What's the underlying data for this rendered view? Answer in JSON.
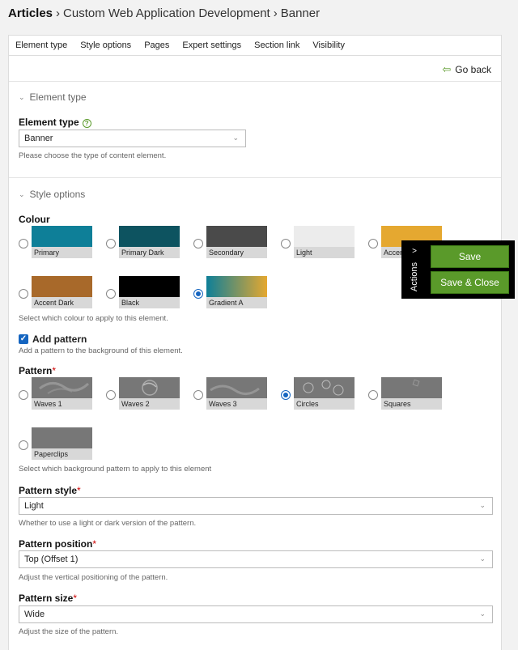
{
  "breadcrumb": {
    "root": "Articles",
    "items": [
      "Custom Web Application Development",
      "Banner"
    ]
  },
  "tabs": [
    "Element type",
    "Style options",
    "Pages",
    "Expert settings",
    "Section link",
    "Visibility"
  ],
  "go_back": "Go back",
  "element_type_section": {
    "title": "Element type",
    "label": "Element type",
    "value": "Banner",
    "hint": "Please choose the type of content element."
  },
  "style_section": {
    "title": "Style options",
    "colour_label": "Colour",
    "colours": [
      {
        "name": "Primary",
        "color": "#0e7f98"
      },
      {
        "name": "Primary Dark",
        "color": "#0d5360"
      },
      {
        "name": "Secondary",
        "color": "#4a4a4a"
      },
      {
        "name": "Light",
        "color": "#ececec"
      },
      {
        "name": "Accent",
        "color": "#e5a830"
      },
      {
        "name": "Accent Dark",
        "color": "#a8692a"
      },
      {
        "name": "Black",
        "color": "#000000"
      },
      {
        "name": "Gradient A",
        "color": "linear-gradient(90deg,#0e7f98,#e5a830)"
      }
    ],
    "selected_colour": "Gradient A",
    "colour_hint": "Select which colour to apply to this element.",
    "add_pattern_label": "Add pattern",
    "add_pattern_hint": "Add a pattern to the background of this element.",
    "pattern_label": "Pattern",
    "required_mark": "*",
    "patterns": [
      "Waves 1",
      "Waves 2",
      "Waves 3",
      "Circles",
      "Squares",
      "Paperclips"
    ],
    "selected_pattern": "Circles",
    "pattern_hint": "Select which background pattern to apply to this element",
    "pattern_style_label": "Pattern style",
    "pattern_style_value": "Light",
    "pattern_style_hint": "Whether to use a light or dark version of the pattern.",
    "pattern_position_label": "Pattern position",
    "pattern_position_value": "Top (Offset 1)",
    "pattern_position_hint": "Adjust the vertical positioning of the pattern.",
    "pattern_size_label": "Pattern size",
    "pattern_size_value": "Wide",
    "pattern_size_hint": "Adjust the size of the pattern."
  },
  "actions": {
    "tab_label": "Actions",
    "save": "Save",
    "save_close": "Save & Close",
    "accent": "#5a9a2a"
  }
}
